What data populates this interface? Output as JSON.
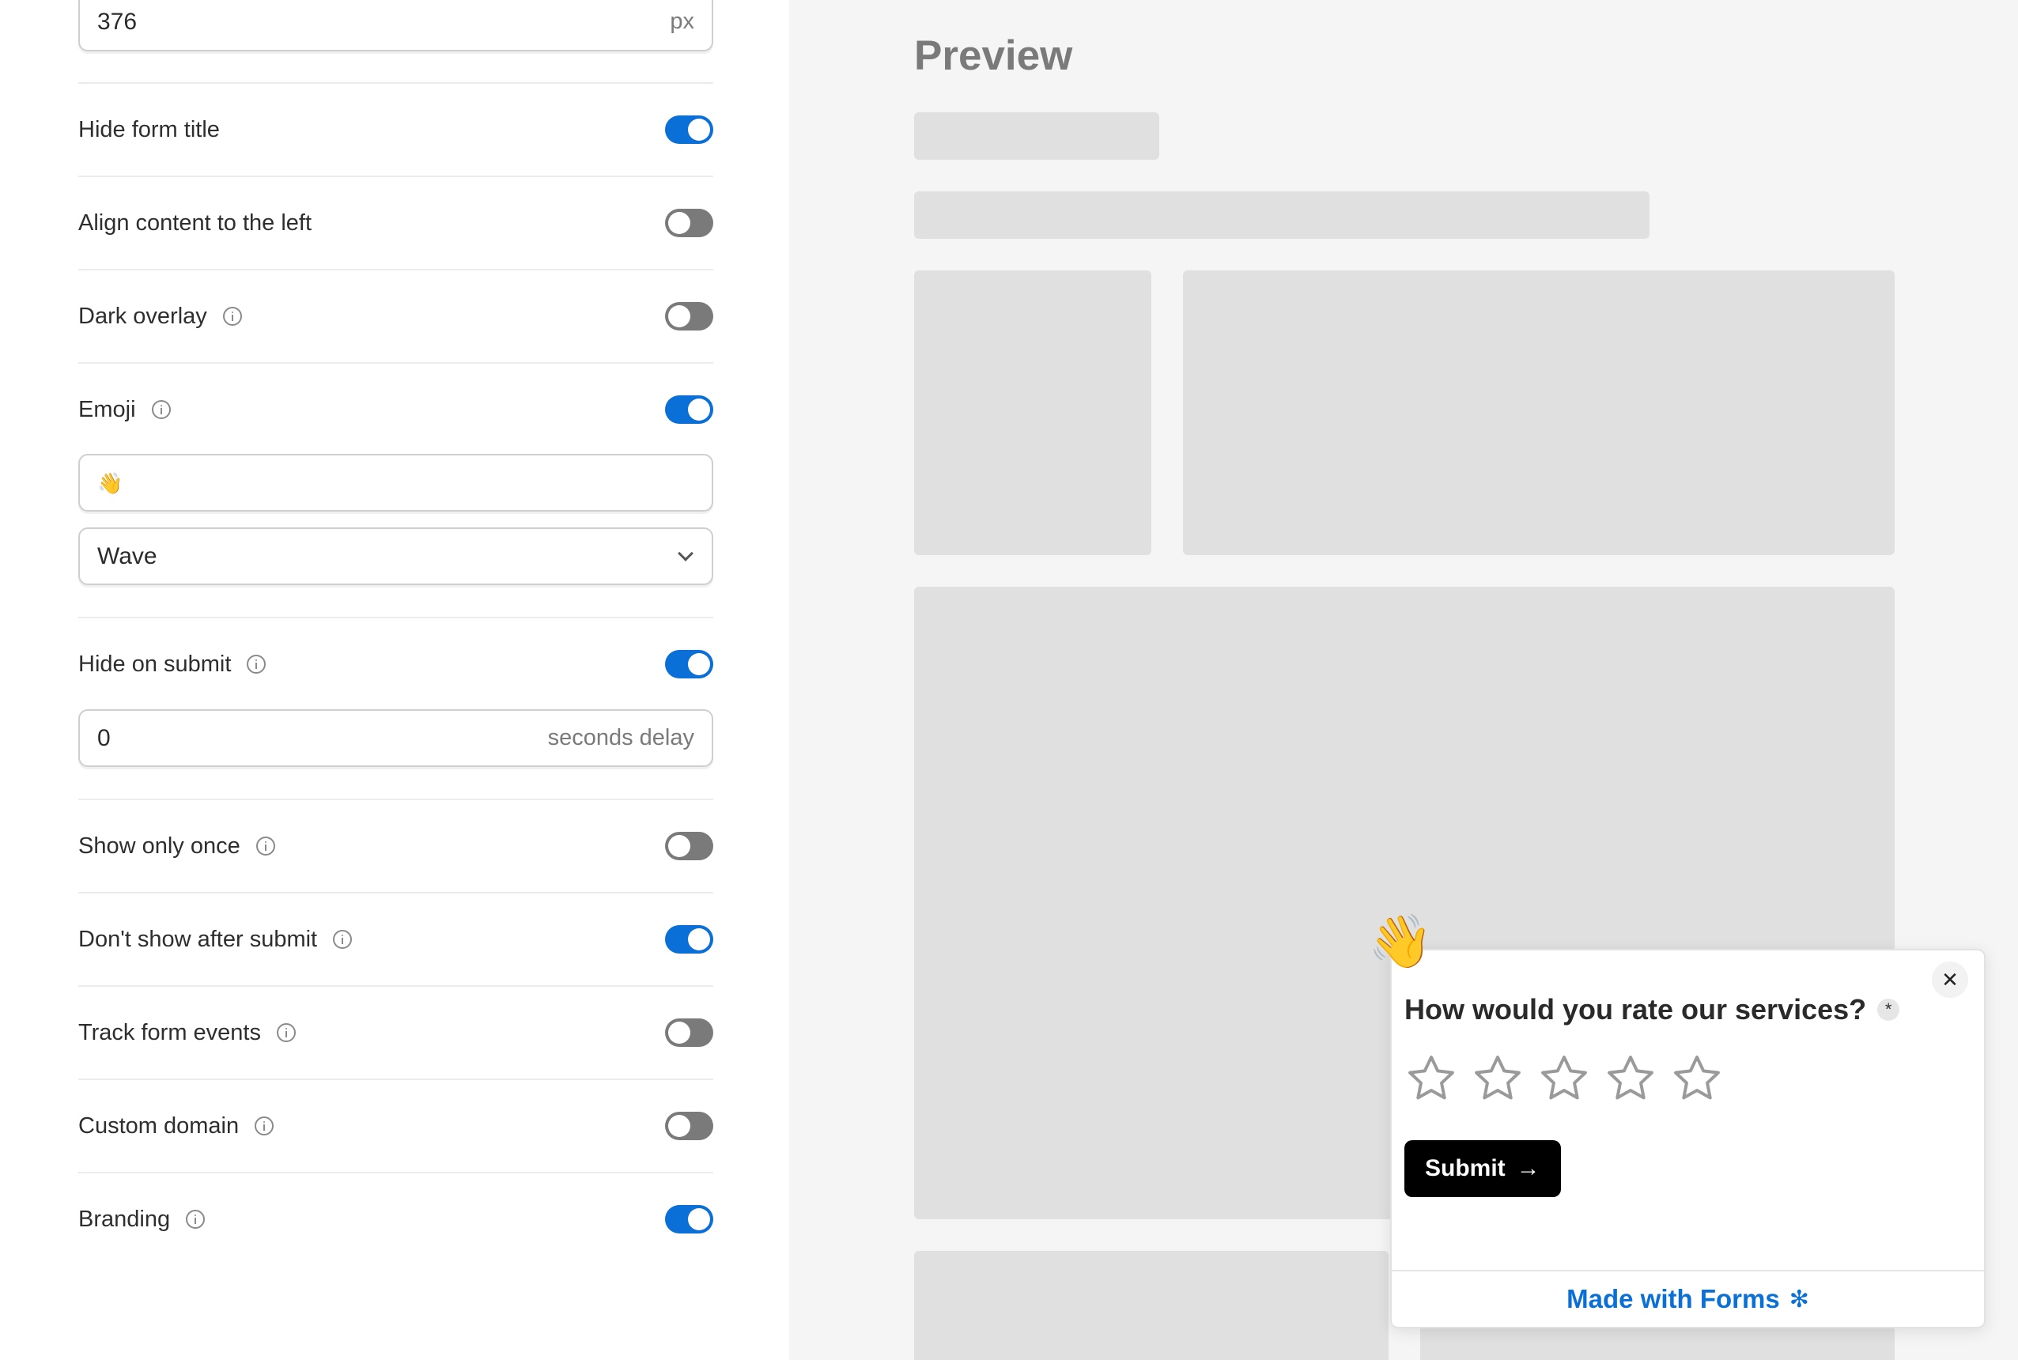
{
  "settings": {
    "width_input": {
      "value": "376",
      "suffix": "px"
    },
    "rows": [
      {
        "label": "Hide form title",
        "info": false,
        "on": true
      },
      {
        "label": "Align content to the left",
        "info": false,
        "on": false
      },
      {
        "label": "Dark overlay",
        "info": true,
        "on": false
      },
      {
        "label": "Emoji",
        "info": true,
        "on": true
      },
      {
        "label": "Hide on submit",
        "info": true,
        "on": true
      },
      {
        "label": "Show only once",
        "info": true,
        "on": false
      },
      {
        "label": "Don't show after submit",
        "info": true,
        "on": true
      },
      {
        "label": "Track form events",
        "info": true,
        "on": false
      },
      {
        "label": "Custom domain",
        "info": true,
        "on": false
      },
      {
        "label": "Branding",
        "info": true,
        "on": true
      }
    ],
    "emoji_input": {
      "value": "👋"
    },
    "emoji_select": {
      "selected": "Wave"
    },
    "delay_input": {
      "value": "0",
      "suffix": "seconds delay"
    }
  },
  "preview": {
    "title": "Preview",
    "popup": {
      "emoji": "👋",
      "close": "✕",
      "question": "How would you rate our services?",
      "required_mark": "*",
      "stars": 5,
      "submit_label": "Submit",
      "submit_icon": "→",
      "footer": "Made with Forms",
      "footer_icon": "✻"
    }
  },
  "colors": {
    "accent": "#0a6fd6",
    "toggle_off": "#7a7a7a",
    "preview_bg": "#f5f5f5",
    "placeholder": "#e0e0e0"
  }
}
